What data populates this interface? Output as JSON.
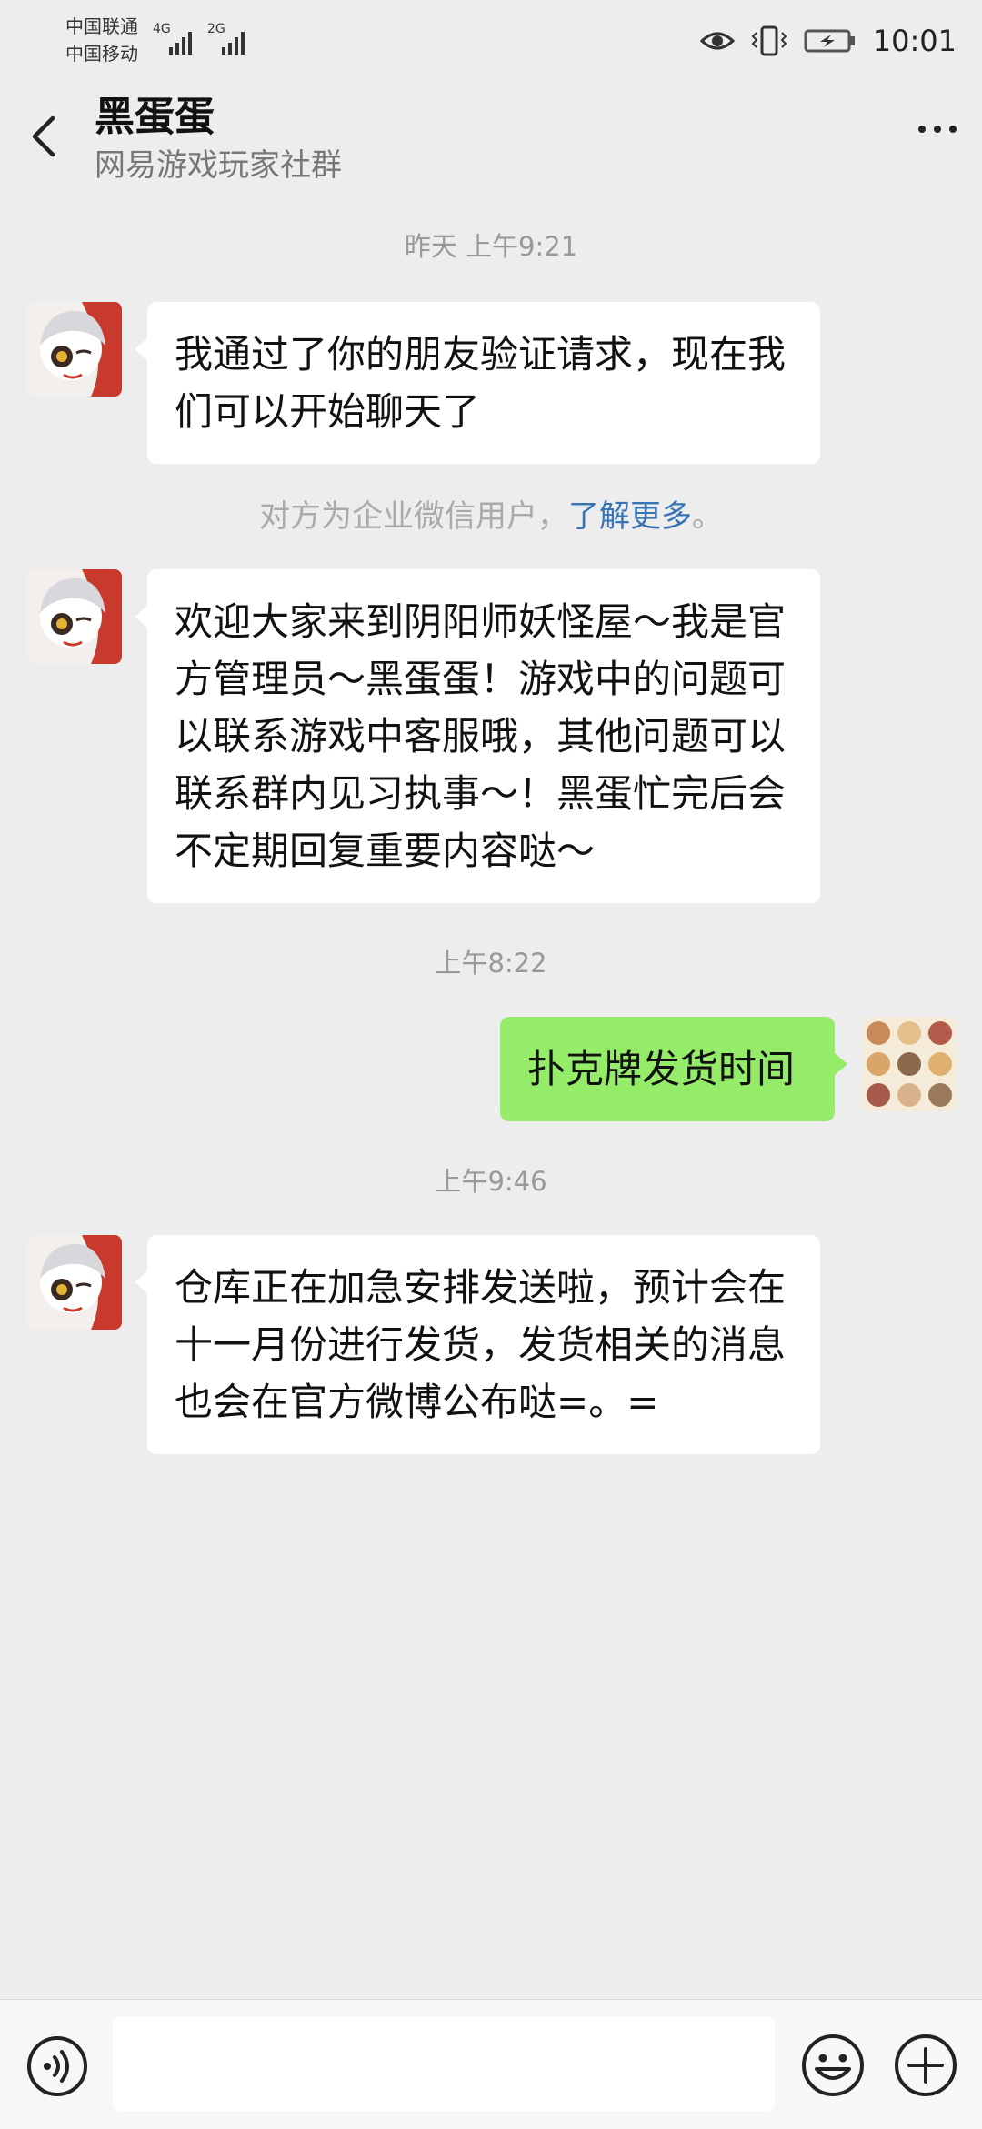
{
  "status_bar": {
    "carrier_1": "中国联通",
    "carrier_2": "中国移动",
    "net_1": "4G",
    "net_2": "2G",
    "time": "10:01"
  },
  "header": {
    "title": "黑蛋蛋",
    "subtitle": "网易游戏玩家社群"
  },
  "chat": {
    "ts1": "昨天 上午9:21",
    "msg1": "我通过了你的朋友验证请求，现在我们可以开始聊天了",
    "notice_text": "对方为企业微信用户，",
    "notice_link": "了解更多",
    "notice_end": "。",
    "msg2": "欢迎大家来到阴阳师妖怪屋～我是官方管理员～黑蛋蛋！游戏中的问题可以联系游戏中客服哦，其他问题可以联系群内见习执事～！黑蛋忙完后会不定期回复重要内容哒～",
    "ts2": "上午8:22",
    "msg3": "扑克牌发货时间",
    "ts3": "上午9:46",
    "msg4": "仓库正在加急安排发送啦，预计会在十一月份进行发货，发货相关的消息也会在官方微博公布哒=。="
  },
  "colors": {
    "background": "#ededed",
    "own_bubble": "#95ec69",
    "other_bubble": "#ffffff",
    "link": "#3874b4"
  },
  "icons": [
    "back-arrow-icon",
    "more-icon",
    "eye-icon",
    "vibrate-icon",
    "battery-icon",
    "voice-icon",
    "emoji-icon",
    "plus-icon"
  ]
}
